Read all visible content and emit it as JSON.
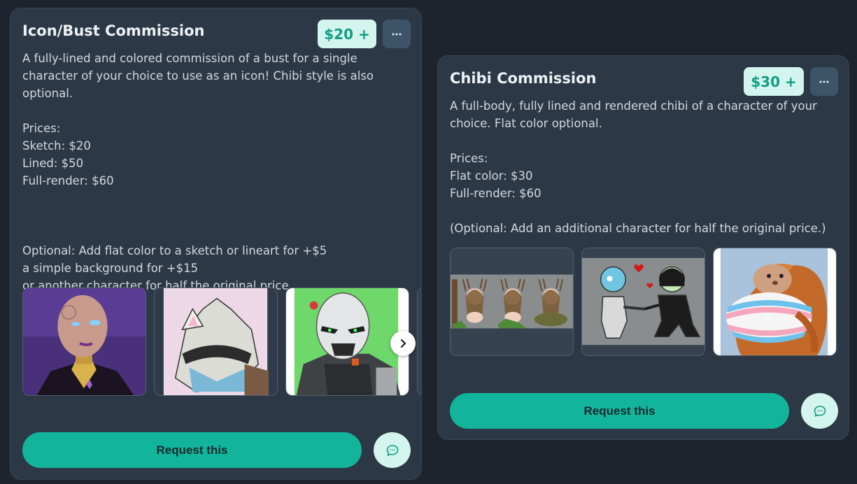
{
  "cards": [
    {
      "title": "Icon/Bust Commission",
      "price": "$20 +",
      "description": "A fully-lined and colored commission of a bust for a single character of your choice to use as an icon! Chibi style is also optional.\n\nPrices:\nSketch: $20\nLined: $50\nFull-render: $60\n\n\n\nOptional: Add flat color to a sketch or lineart for +$5\na simple background for +$15\nor another character for half the original price",
      "images": [
        "bust-portrait-purple-background",
        "knight-helmet-cat-ears-sketch",
        "robot-mask-character-green-background"
      ],
      "request_label": "Request this",
      "icons": {
        "more": "more-dots-icon",
        "next": "chevron-right-icon",
        "chat": "chat-bubble-icon"
      }
    },
    {
      "title": "Chibi Commission",
      "price": "$30 +",
      "description": "A full-body, fully lined and rendered chibi of a character of your choice. Flat color optional.\n\nPrices:\nFlat color: $30\nFull-render: $60\n\n(Optional: Add an additional character for half the original price.)",
      "images": [
        "three-antlered-chibis",
        "two-chibis-holding-hands-hearts",
        "pangolin-trans-flag"
      ],
      "request_label": "Request this",
      "icons": {
        "more": "more-dots-icon",
        "chat": "chat-bubble-icon"
      }
    }
  ],
  "colors": {
    "page_bg": "#1e242d",
    "card_bg": "#2c3845",
    "accent": "#12b59c",
    "badge_bg": "#d4f5ee",
    "badge_text": "#119d84"
  }
}
